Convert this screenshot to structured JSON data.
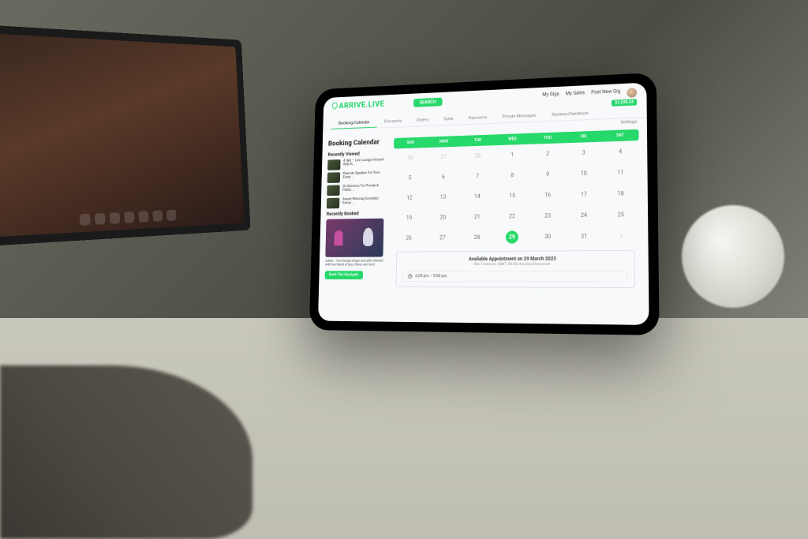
{
  "brand": "ARRIVE.LIVE",
  "search_button": "SEARCH",
  "top_links": {
    "my_gigs": "My Gigs",
    "my_sales": "My Sales",
    "post_new": "Post New Gig"
  },
  "balance": "$1,035.24",
  "tabs": [
    "Booking/Calendar",
    "Discounts",
    "Orders",
    "Sales",
    "Payments",
    "Private Messages",
    "Reviews/Feedback"
  ],
  "settings_label": "Settings",
  "page_title": "Booking Calendar",
  "recently_viewed_title": "Recently Viewed",
  "recently_viewed": [
    {
      "title": "4 dkd – Live Lounge Infused With R…"
    },
    {
      "title": "Keynote Speaker For Your Event …"
    },
    {
      "title": "DJ Services For Private & Public …"
    },
    {
      "title": "Award Winning Acrobatic Group …"
    }
  ],
  "recently_booked_title": "Recently Booked",
  "recently_booked_desc": "Jukes – live lounge singer acoustic infused with live blend of jazz, blues and soul",
  "book_again_label": "Book This Gig Again",
  "dow": [
    "SUN",
    "MON",
    "TUE",
    "WED",
    "THU",
    "FRI",
    "SAT"
  ],
  "calendar": {
    "rows": [
      [
        "26",
        "27",
        "28",
        "1",
        "2",
        "3",
        "4"
      ],
      [
        "5",
        "6",
        "7",
        "8",
        "9",
        "10",
        "11"
      ],
      [
        "12",
        "13",
        "14",
        "15",
        "16",
        "17",
        "18"
      ],
      [
        "19",
        "20",
        "21",
        "22",
        "23",
        "24",
        "25"
      ],
      [
        "26",
        "27",
        "28",
        "29",
        "30",
        "31",
        "1"
      ]
    ],
    "prev_month_cells": [
      0,
      1,
      2
    ],
    "next_month_cells": [
      34
    ],
    "selected_index": 31
  },
  "appointment": {
    "title": "Available Appointment on 29 March 2023",
    "subtitle": "Site Timezone: (GMT -08:00) America/Vancouver",
    "slot": "6:00 pm – 9:00 pm"
  }
}
